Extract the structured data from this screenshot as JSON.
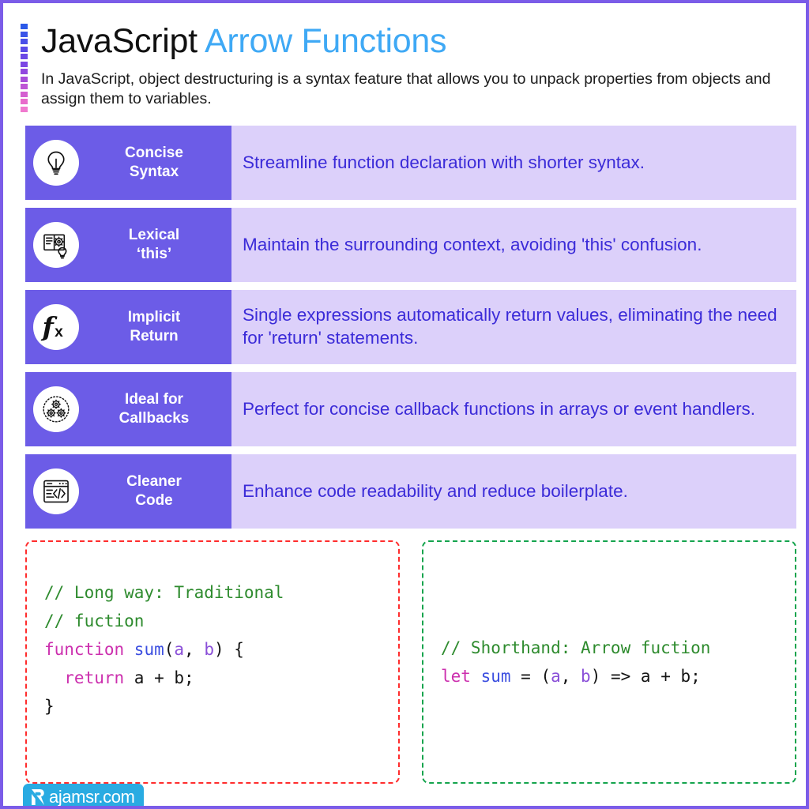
{
  "page": {
    "border_color": "#7B5CE8",
    "background": "#ffffff"
  },
  "decoration": {
    "name": "dotted-gradient-rail",
    "dot_colors": [
      "#2B59E8",
      "#3A54E8",
      "#4A4FE8",
      "#5A4AE8",
      "#6B48E6",
      "#7C46E4",
      "#9248DF",
      "#A84DDA",
      "#BE55D6",
      "#D45FD0",
      "#E86BCB",
      "#F07ACF"
    ]
  },
  "header": {
    "title_primary": "JavaScript",
    "title_accent": "Arrow Functions",
    "accent_color": "#3FA9F5",
    "subtitle": "In JavaScript, object destructuring is a syntax feature that allows you to unpack properties from objects and assign them to variables."
  },
  "features": [
    {
      "icon": "lightbulb-icon",
      "label": "Concise\nSyntax",
      "description": "Streamline function declaration with shorter syntax."
    },
    {
      "icon": "book-gear-lightbulb-icon",
      "label": "Lexical\n‘this’",
      "description": "Maintain the surrounding context, avoiding 'this' confusion."
    },
    {
      "icon": "function-fx-icon",
      "label": "Implicit\nReturn",
      "description": "Single expressions automatically return values, eliminating the need for 'return' statements."
    },
    {
      "icon": "gears-circle-icon",
      "label": "Ideal for\nCallbacks",
      "description": "Perfect for concise callback functions in arrays or event handlers."
    },
    {
      "icon": "browser-code-icon",
      "label": "Cleaner\nCode",
      "description": "Enhance code readability and reduce boilerplate."
    }
  ],
  "feature_colors": {
    "label_bg": "#6C5CE7",
    "label_text": "#ffffff",
    "desc_bg": "#DCD0FA",
    "desc_text": "#3B2BD8",
    "desc_accent_bar": "#6C5CE7"
  },
  "code_blocks": {
    "left": {
      "border_color": "#FF2D2D",
      "border_style": "dashed",
      "tokens": [
        [
          {
            "t": "// Long way: Traditional",
            "c": "comment"
          }
        ],
        [
          {
            "t": "// fuction",
            "c": "comment"
          }
        ],
        [
          {
            "t": "function ",
            "c": "keyword"
          },
          {
            "t": "sum",
            "c": "fn"
          },
          {
            "t": "(",
            "c": "plain"
          },
          {
            "t": "a",
            "c": "param"
          },
          {
            "t": ", ",
            "c": "plain"
          },
          {
            "t": "b",
            "c": "param"
          },
          {
            "t": ") {",
            "c": "plain"
          }
        ],
        [
          {
            "t": "  return ",
            "c": "keyword"
          },
          {
            "t": "a + b;",
            "c": "plain"
          }
        ],
        [
          {
            "t": "}",
            "c": "plain"
          }
        ]
      ]
    },
    "right": {
      "border_color": "#14A44D",
      "border_style": "dashed",
      "tokens": [
        [
          {
            "t": "// Shorthand: Arrow fuction",
            "c": "comment"
          }
        ],
        [
          {
            "t": "let ",
            "c": "keyword"
          },
          {
            "t": "sum",
            "c": "fn"
          },
          {
            "t": " = (",
            "c": "plain"
          },
          {
            "t": "a",
            "c": "param"
          },
          {
            "t": ", ",
            "c": "plain"
          },
          {
            "t": "b",
            "c": "param"
          },
          {
            "t": ") => a + b;",
            "c": "plain"
          }
        ]
      ]
    },
    "syntax_colors": {
      "comment": "#2E8B2E",
      "keyword": "#CC2FAE",
      "fn": "#3B4EE0",
      "param": "#8A4FD8",
      "plain": "#141414"
    }
  },
  "watermark": {
    "text": "ajamsr.com",
    "logo": "rajamsr-bookmark-logo",
    "background": "#29ABE2",
    "text_color": "#ffffff"
  }
}
